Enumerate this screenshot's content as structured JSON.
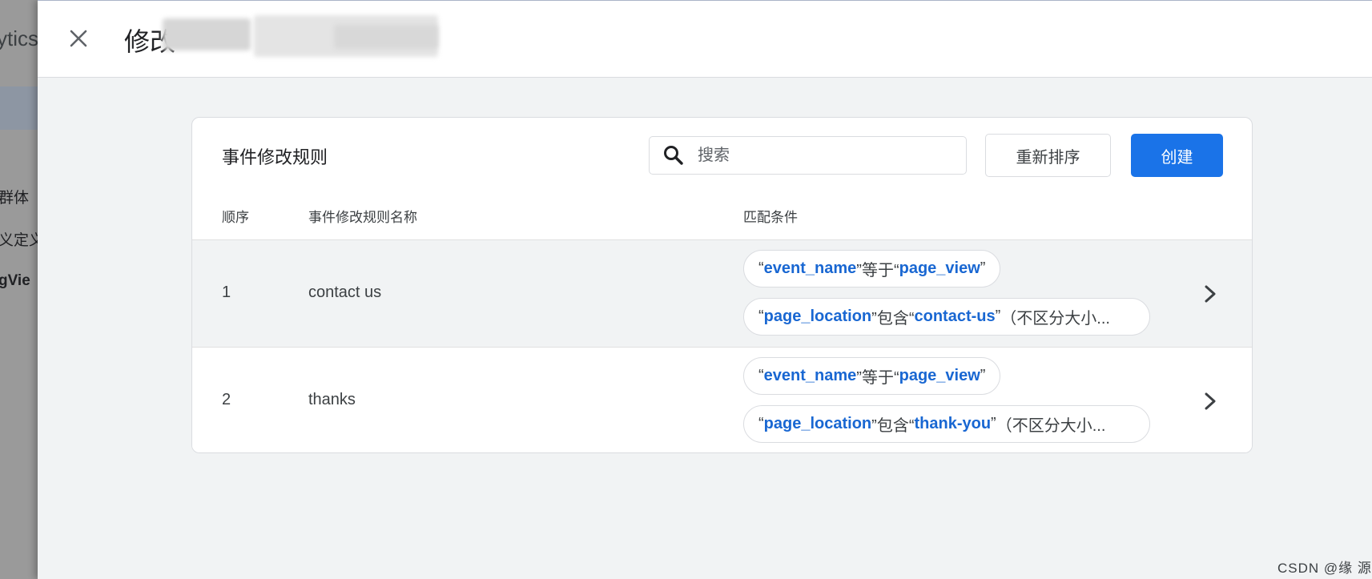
{
  "background": {
    "title": "ytics",
    "nav_items": [
      "群体",
      "义定义",
      "gVie"
    ]
  },
  "header": {
    "title": "修改"
  },
  "card": {
    "title": "事件修改规则",
    "search_placeholder": "搜索",
    "reorder_label": "重新排序",
    "create_label": "创建",
    "columns": {
      "order": "顺序",
      "name": "事件修改规则名称",
      "conditions": "匹配条件"
    },
    "rows": [
      {
        "order": "1",
        "name": "contact us",
        "conditions": [
          {
            "open": "“",
            "key": "event_name",
            "op": "”等于“",
            "value": "page_view",
            "close": "”",
            "suffix": ""
          },
          {
            "open": "“",
            "key": "page_location",
            "op": "”包含“",
            "value": "contact-us",
            "close": "”",
            "suffix": "（不区分大小..."
          }
        ]
      },
      {
        "order": "2",
        "name": "thanks",
        "conditions": [
          {
            "open": "“",
            "key": "event_name",
            "op": "”等于“",
            "value": "page_view",
            "close": "”",
            "suffix": ""
          },
          {
            "open": "“",
            "key": "page_location",
            "op": "”包含“",
            "value": "thank-you",
            "close": "”",
            "suffix": "（不区分大小..."
          }
        ]
      }
    ]
  },
  "watermark": "CSDN @缘 源 园",
  "colors": {
    "accent": "#1a73e8",
    "link_text": "#1967d2",
    "panel_bg": "#f1f3f4"
  },
  "icons": {
    "close": "close-icon",
    "search": "search-icon",
    "row_action": "chevron-right-icon"
  }
}
